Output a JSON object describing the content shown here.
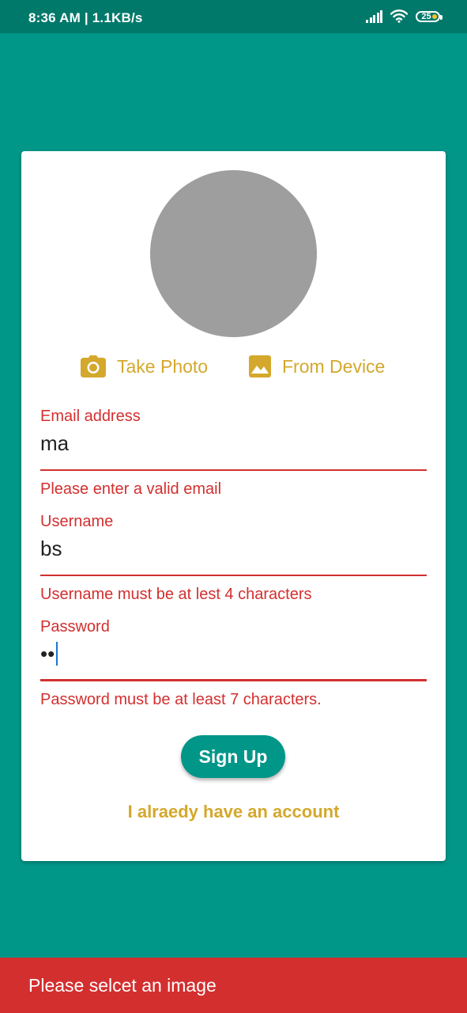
{
  "status_bar": {
    "left_text": "8:36 AM | 1.1KB/s",
    "battery_level": "25"
  },
  "photo_actions": {
    "take_photo_label": "Take Photo",
    "from_device_label": "From Device",
    "accent_color": "#D4A82C",
    "take_photo_icon": "camera-icon",
    "from_device_icon": "image-icon"
  },
  "form": {
    "email": {
      "label": "Email address",
      "value": "ma",
      "error": "Please enter a valid email"
    },
    "username": {
      "label": "Username",
      "value": "bs",
      "error": "Username must be at lest 4 characters"
    },
    "password": {
      "label": "Password",
      "value": "••",
      "error": "Password must be at least 7 characters."
    },
    "error_color": "#D32F2F"
  },
  "actions": {
    "signup_label": "Sign Up",
    "login_link": "I alraedy have an account"
  },
  "snackbar": {
    "message": "Please selcet an image",
    "color": "#D32F2F"
  },
  "colors": {
    "background": "#009688",
    "status_bar": "#00796B",
    "avatar_placeholder": "#9E9E9E"
  }
}
